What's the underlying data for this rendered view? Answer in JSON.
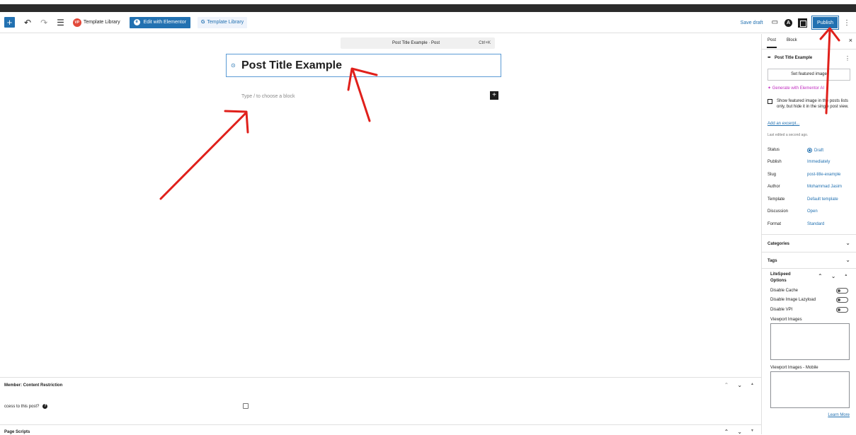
{
  "toolbar": {
    "add_block_label": "+",
    "undo_icon": "undo-icon",
    "redo_icon": "redo-icon",
    "list_view_icon": "list-view-icon",
    "template_library_label": "Template Library",
    "template_library_logo": "VP",
    "edit_elementor_label": "Edit with Elementor",
    "template_library2_label": "Template Library",
    "save_draft_label": "Save draft",
    "astra_letter": "A",
    "publish_label": "Publish"
  },
  "command_bar": {
    "title": "Post Title Example · Post",
    "shortcut": "Ctrl+K"
  },
  "editor": {
    "post_title": "Post Title Example",
    "block_placeholder": "Type / to choose a block",
    "add_block_label": "+"
  },
  "meta_boxes": {
    "member_title": "Member: Content Restriction",
    "access_question": "ccess to this post?",
    "help_label": "?",
    "page_scripts_title": "Page Scripts"
  },
  "sidebar": {
    "tabs": [
      {
        "label": "Post",
        "active": true
      },
      {
        "label": "Block",
        "active": false
      }
    ],
    "close_label": "×",
    "doc_title": "Post Title Example",
    "set_featured_image_label": "Set featured image",
    "generate_ai_label": "Generate with Elementor AI",
    "show_featured_label": "Show featured image in the posts lists only, but hide it in the single post view.",
    "add_excerpt_label": "Add an excerpt...",
    "last_edited": "Last edited a second ago.",
    "meta": [
      {
        "key": "Status",
        "value": "Draft"
      },
      {
        "key": "Publish",
        "value": "Immediately"
      },
      {
        "key": "Slug",
        "value": "post-title-example"
      },
      {
        "key": "Author",
        "value": "Mohammad Jasim"
      },
      {
        "key": "Template",
        "value": "Default template"
      },
      {
        "key": "Discussion",
        "value": "Open"
      },
      {
        "key": "Format",
        "value": "Standard"
      }
    ],
    "categories_label": "Categories",
    "tags_label": "Tags",
    "litespeed_title": "LiteSpeed Options",
    "litespeed_toggles": [
      {
        "label": "Disable Cache"
      },
      {
        "label": "Disable Image Lazyload"
      },
      {
        "label": "Disable VPI"
      }
    ],
    "viewport_images_label": "Viewport Images",
    "viewport_images_mobile_label": "Viewport Images - Mobile",
    "learn_more_label": "Learn More"
  },
  "colors": {
    "accent": "#2271b1",
    "annotation_red": "#e0201b",
    "ai_magenta": "#c12ec1"
  }
}
